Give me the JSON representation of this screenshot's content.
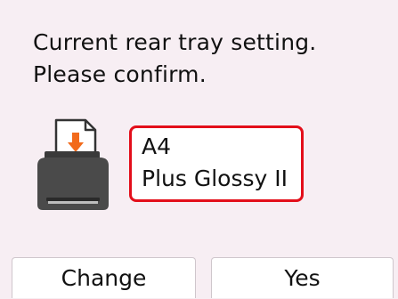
{
  "dialog": {
    "message_line1": "Current rear tray setting.",
    "message_line2": "Please confirm."
  },
  "paper_setting": {
    "size": "A4",
    "type": "Plus Glossy II",
    "highlight_color": "#e30e1a"
  },
  "icons": {
    "printer": "printer-rear-tray-icon",
    "arrow": "arrow-down-icon",
    "arrow_color": "#f26a1b"
  },
  "buttons": {
    "change_label": "Change",
    "yes_label": "Yes"
  }
}
